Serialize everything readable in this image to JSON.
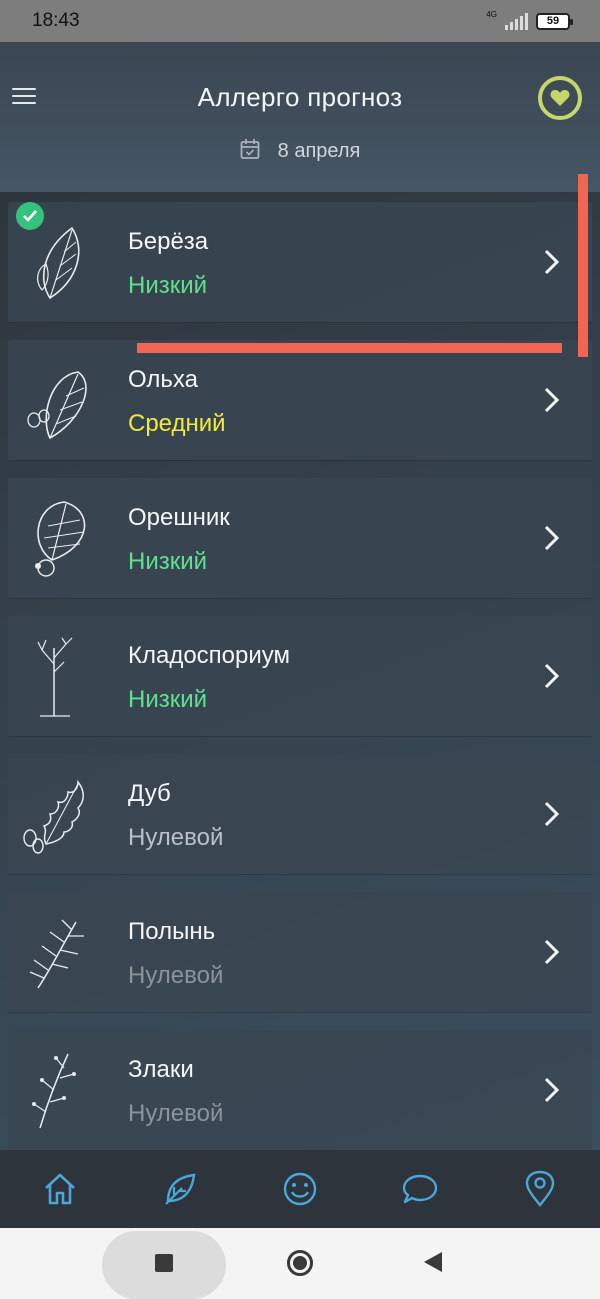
{
  "status_bar": {
    "time": "18:43",
    "network": "4G",
    "battery": "59"
  },
  "header": {
    "title": "Аллерго прогноз",
    "date": "8 апреля"
  },
  "plants": [
    {
      "name": "Берёза",
      "level": "Низкий",
      "level_color": "#5fe08f",
      "checked": true
    },
    {
      "name": "Ольха",
      "level": "Средний",
      "level_color": "#f2ea3a"
    },
    {
      "name": "Орешник",
      "level": "Низкий",
      "level_color": "#5fe08f"
    },
    {
      "name": "Кладоспориум",
      "level": "Низкий",
      "level_color": "#5fe08f"
    },
    {
      "name": "Дуб",
      "level": "Нулевой",
      "level_color": "#b9c0c7"
    },
    {
      "name": "Полынь",
      "level": "Нулевой",
      "level_color": "#8b939b"
    },
    {
      "name": "Злаки",
      "level": "Нулевой",
      "level_color": "#8b939b"
    }
  ],
  "bottom_nav": [
    "home-icon",
    "leaf-icon",
    "smile-icon",
    "chat-icon",
    "location-icon"
  ],
  "colors": {
    "accent": "#4aa7d8",
    "annotation": "#f26552",
    "heart": "#c4d86a"
  }
}
